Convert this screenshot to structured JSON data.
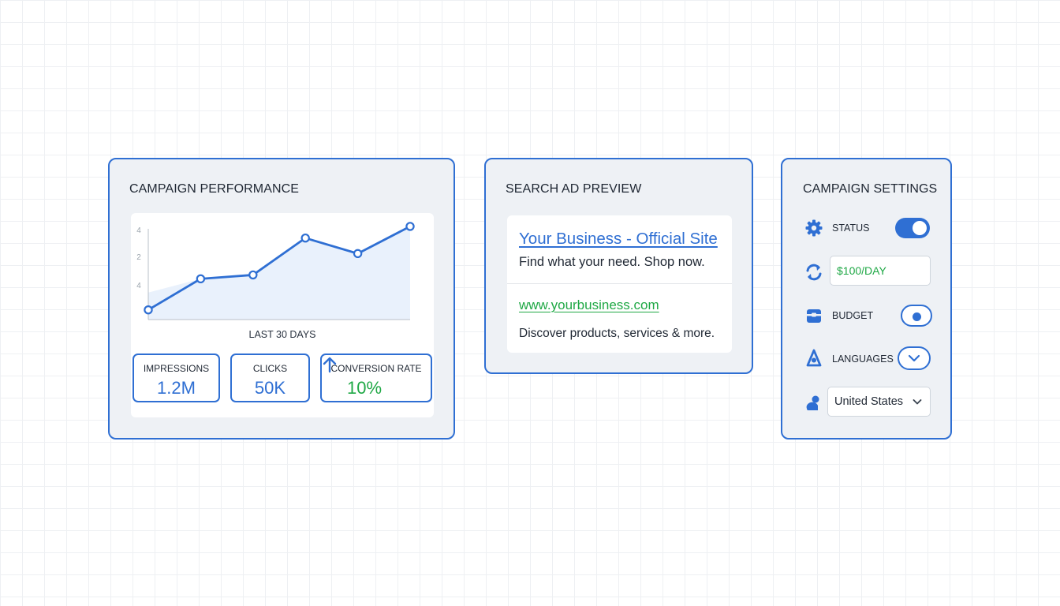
{
  "colors": {
    "accent": "#2f6fd3",
    "positive": "#1fa845",
    "panel_bg": "#eef1f5",
    "area_fill": "#e9f1fc"
  },
  "performance": {
    "title": "CAMPAIGN PERFORMANCE",
    "range_label": "LAST 30 DAYS",
    "metrics": [
      {
        "label": "IMPRESSIONS",
        "value": "1.2M"
      },
      {
        "label": "CLICKS",
        "value": "50K"
      },
      {
        "label": "CONVERSION RATE",
        "value": "10%",
        "trend_icon": "arrow-up-icon"
      }
    ]
  },
  "chart_data": {
    "type": "area",
    "title": "",
    "xlabel": "",
    "ylabel": "",
    "y_ticks": [
      "4",
      "2",
      "4"
    ],
    "ylim": [
      0,
      5
    ],
    "grid": false,
    "x": [
      1,
      2,
      3,
      4,
      5,
      6
    ],
    "series": [
      {
        "values": [
          0.5,
          2.1,
          2.3,
          4.2,
          3.4,
          4.8
        ]
      }
    ]
  },
  "ad_preview": {
    "title": "SEARCH AD PREVIEW",
    "headline": "Your Business - Official Site",
    "description_1": "Find what your need. Shop now.",
    "display_url": "www.yourbusiness.com",
    "description_2": "Discover products, services & more."
  },
  "settings": {
    "title": "CAMPAIGN SETTINGS",
    "status_label": "STATUS",
    "status_icon": "gear-icon",
    "status_on": true,
    "daily_budget_value": "$100/DAY",
    "daily_budget_icon": "sync-icon",
    "budget_label": "BUDGET",
    "budget_icon": "wallet-icon",
    "budget_selected": true,
    "languages_label": "LANGUAGES",
    "languages_icon": "person-pin-icon",
    "languages_dropdown_icon": "chevron-down-icon",
    "location_icon": "person-icon",
    "location_value": "United States"
  }
}
